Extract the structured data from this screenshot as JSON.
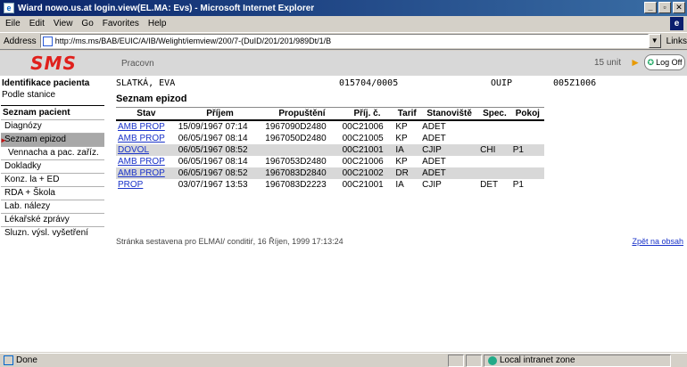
{
  "window": {
    "title": "Wiard nowo.us.at login.view(EL.MA: Evs) - Microsoft Internet Explorer",
    "controls": [
      "_",
      "▫",
      "✕"
    ]
  },
  "menu": {
    "items": [
      "Eile",
      "Edit",
      "View",
      "Go",
      "Favorites",
      "Help"
    ],
    "brand_glyph": "e"
  },
  "address": {
    "label": "Address",
    "url": "http://ms.ms/BAB/EUIC/A/IB/Welight/iemview/200/7-(DuID/201/201/989Dt/1/B",
    "links_label": "Links"
  },
  "header": {
    "logo": "SMS",
    "user": "Pracovn",
    "right_text": "15 unit",
    "logoff": "Log Off"
  },
  "sidebar": {
    "heading": "Identifikace pacienta",
    "link": "Podle stanice",
    "section_title": "Seznam pacient",
    "items": [
      "Diagnózy",
      "Seznam epizod",
      "Vennacha a pac. zaříz.",
      "Dokladky",
      "Konz. la + ED",
      "RDA + Škola",
      "Lab. nálezy",
      "Lékařské zprávy",
      "Sluzn. výsl. vyšetření"
    ],
    "active_index": 1
  },
  "patient": {
    "name": "SLATKÁ, EVA",
    "id": "015704/0005",
    "station": "OUIP",
    "code": "005Z1006"
  },
  "episodes": {
    "title": "Seznam epizod",
    "columns": [
      "Stav",
      "Příjem",
      "Propuštění",
      "Příj. č.",
      "Tarif",
      "Stanoviště",
      "Spec.",
      "Pokoj"
    ],
    "rows": [
      [
        "AMB PROP",
        "15/09/1967 07:14",
        "1967090D2480",
        "00C21006",
        "KP",
        "ADET",
        "",
        ""
      ],
      [
        "AMB PROP",
        "06/05/1967 08:14",
        "1967050D2480",
        "00C21005",
        "KP",
        "ADET",
        "",
        ""
      ],
      [
        "DOVOL",
        "06/05/1967 08:52",
        "",
        "00C21001",
        "IA",
        "CJIP",
        "CHI",
        "P1"
      ],
      [
        "AMB PROP",
        "06/05/1967 08:14",
        "1967053D2480",
        "00C21006",
        "KP",
        "ADET",
        "",
        ""
      ],
      [
        "AMB PROP",
        "06/05/1967 08:52",
        "1967083D2840",
        "00C21002",
        "DR",
        "ADET",
        "",
        ""
      ],
      [
        "PROP",
        "03/07/1967 13:53",
        "1967083D2223",
        "00C21001",
        "IA",
        "CJIP",
        "DET",
        "P1"
      ]
    ],
    "shaded": [
      2,
      4
    ],
    "footnote": "Stránka sestavena pro ELMAI/ conditiŕ, 16 Říjen, 1999 17:13:24",
    "back_link": "Zpět na obsah"
  },
  "status": {
    "text": "Done",
    "zone": "Local intranet zone"
  },
  "colors": {
    "titlebar": "#0a246a",
    "logo": "#e0201c",
    "link": "#1a33c9",
    "chrome": "#d4d0c8"
  }
}
